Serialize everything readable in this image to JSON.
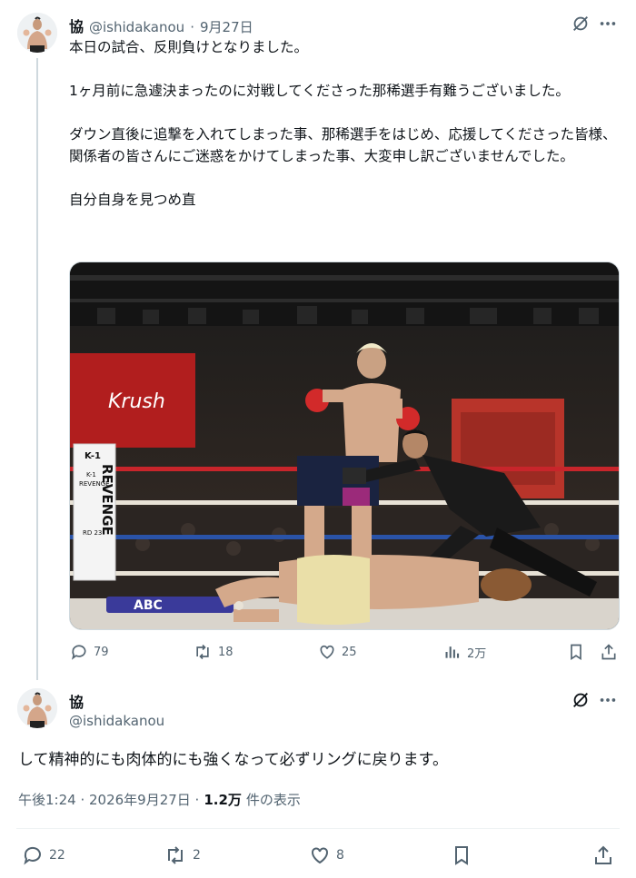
{
  "tweet1": {
    "display_name": "協",
    "handle": "@ishidakanou",
    "separator": "·",
    "date": "9月27日",
    "text": "本日の試合、反則負けとなりました。\n\n1ヶ月前に急遽決まったのに対戦してくださった那稀選手有難うございました。\n\nダウン直後に追撃を入れてしまった事、那稀選手をはじめ、応援してくださった皆様、関係者の皆さんにご迷惑をかけてしまった事、大変申し訳ございませんでした。\n\n自分自身を見つめ直",
    "media": {
      "banner_text": "Krush",
      "ringpost_text_1": "K-1",
      "ringpost_text_2": "REVENGE",
      "ringpost_text_3": "K-1",
      "ringpost_text_4": "REVENGE",
      "ringpost_text_5": "RD 23",
      "apron_text": "ABC"
    },
    "stats": {
      "replies": "79",
      "retweets": "18",
      "likes": "25",
      "views": "2万"
    }
  },
  "tweet2": {
    "display_name": "協",
    "handle": "@ishidakanou",
    "text": "して精神的にも肉体的にも強くなって必ずリングに戻ります。",
    "time": "午後1:24 · 2026年9月27日 ·",
    "views_count": "1.2万",
    "views_label": "件の表示",
    "stats": {
      "replies": "22",
      "retweets": "2",
      "likes": "8"
    }
  },
  "colors": {
    "text": "#0f1419",
    "secondary": "#536471",
    "border": "#cfd9de"
  }
}
